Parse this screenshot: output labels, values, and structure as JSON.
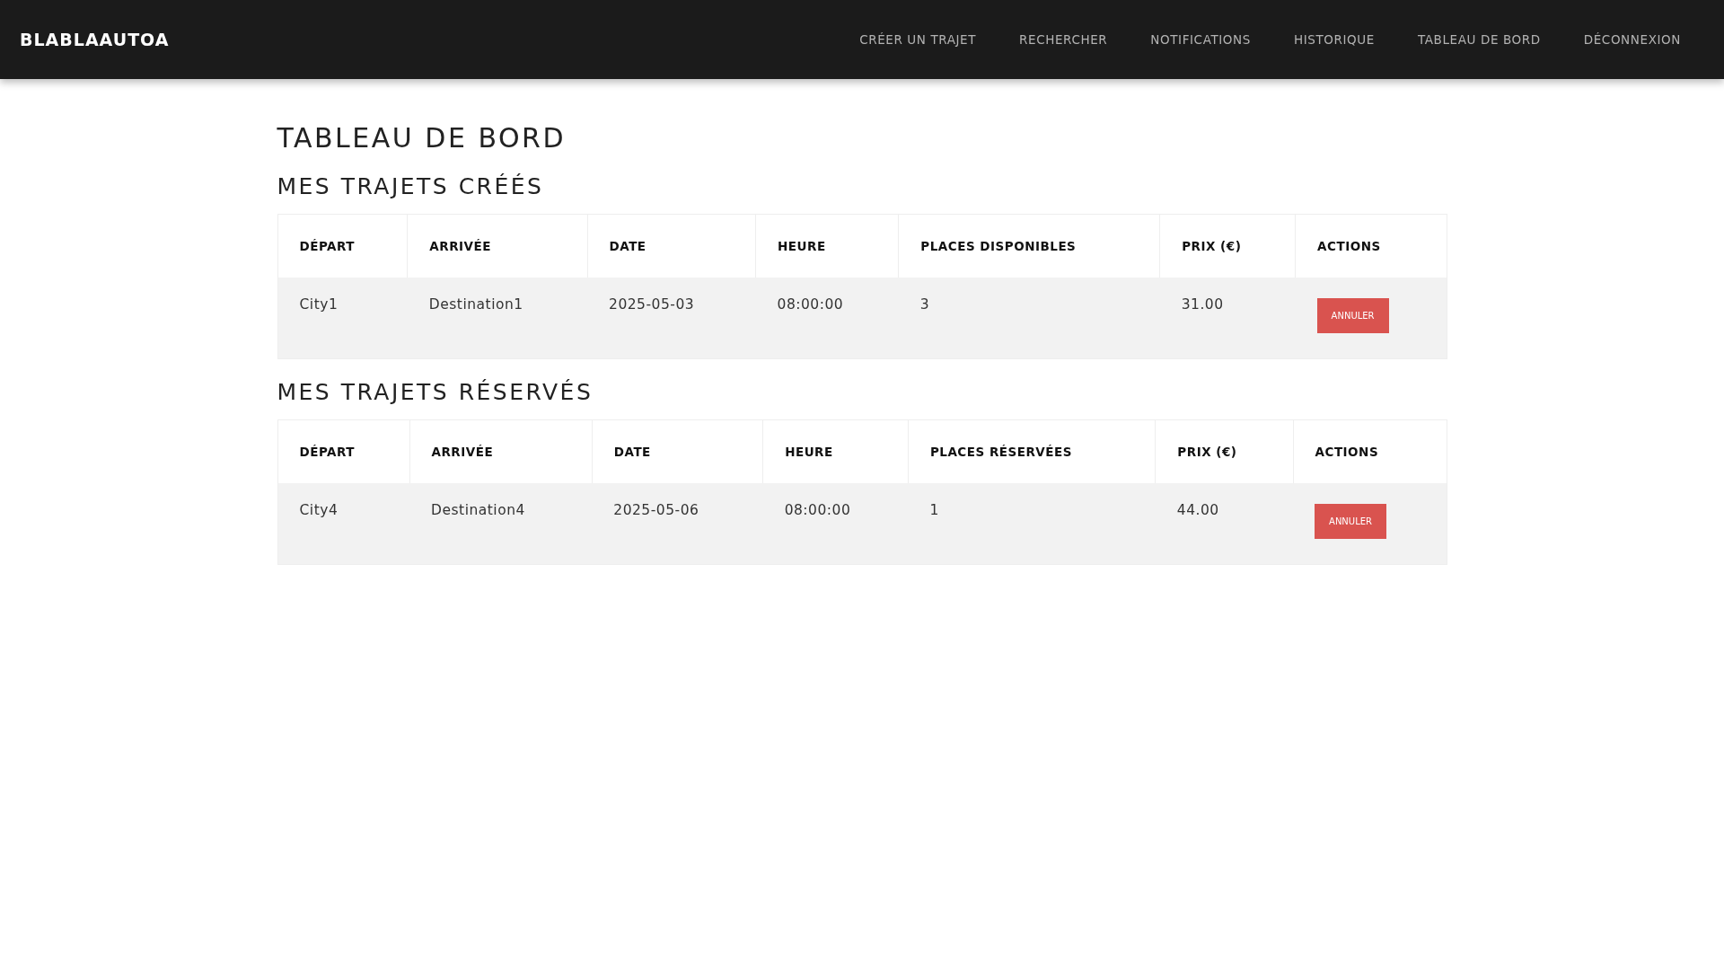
{
  "navbar": {
    "brand": "BLABLAAUTOA",
    "links": [
      "CRÉER UN TRAJET",
      "RECHERCHER",
      "NOTIFICATIONS",
      "HISTORIQUE",
      "TABLEAU DE BORD",
      "DÉCONNEXION"
    ]
  },
  "page_title": "TABLEAU DE BORD",
  "sections": [
    {
      "title": "MES TRAJETS CRÉÉS",
      "columns": [
        "DÉPART",
        "ARRIVÉE",
        "DATE",
        "HEURE",
        "PLACES DISPONIBLES",
        "PRIX (€)",
        "ACTIONS"
      ],
      "rows": [
        {
          "cells": [
            "City1",
            "Destination1",
            "2025-05-03",
            "08:00:00",
            "3",
            "31.00"
          ],
          "action": "ANNULER"
        }
      ]
    },
    {
      "title": "MES TRAJETS RÉSERVÉS",
      "columns": [
        "DÉPART",
        "ARRIVÉE",
        "DATE",
        "HEURE",
        "PLACES RÉSERVÉES",
        "PRIX (€)",
        "ACTIONS"
      ],
      "rows": [
        {
          "cells": [
            "City4",
            "Destination4",
            "2025-05-06",
            "08:00:00",
            "1",
            "44.00"
          ],
          "action": "ANNULER"
        }
      ]
    }
  ]
}
